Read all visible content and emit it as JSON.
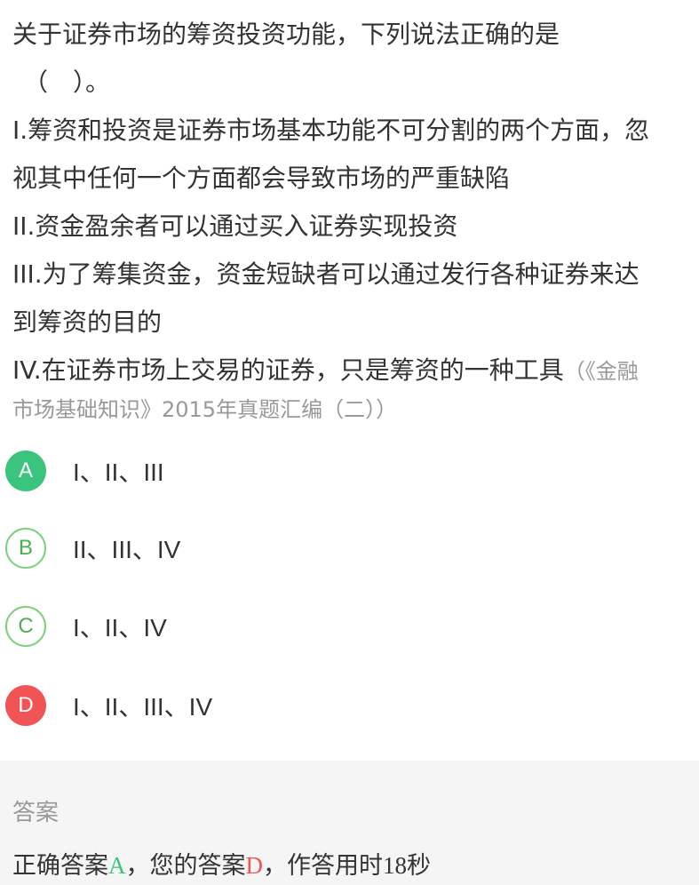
{
  "question": {
    "stem_line1": "关于证券市场的筹资投资功能，下列说法正确的是",
    "stem_line2": "（　）。",
    "item1_line1": "I.筹资和投资是证券市场基本功能不可分割的两个方面，忽",
    "item1_line2": "视其中任何一个方面都会导致市场的严重缺陷",
    "item2": "II.资金盈余者可以通过买入证券实现投资",
    "item3_line1": "III.为了筹集资金，资金短缺者可以通过发行各种证券来达",
    "item3_line2": "到筹资的目的",
    "item4": "IV.在证券市场上交易的证券，只是筹资的一种工具",
    "source_part1": "（《金融",
    "source_part2": "市场基础知识》2015年真题汇编（二））"
  },
  "options": [
    {
      "letter": "A",
      "text": "I、II、III",
      "state": "correct"
    },
    {
      "letter": "B",
      "text": "II、III、IV",
      "state": "plain"
    },
    {
      "letter": "C",
      "text": "I、II、IV",
      "state": "plain"
    },
    {
      "letter": "D",
      "text": "I、II、III、IV",
      "state": "wrong"
    }
  ],
  "answer": {
    "title": "答案",
    "prefix_correct": "正确答案",
    "correct_letter": "A",
    "mid_text": "，您的答案",
    "my_letter": "D",
    "suffix_text": "，作答用时",
    "time_value": "18",
    "time_unit": "秒"
  },
  "colors": {
    "correct": "#3ac47d",
    "wrong": "#f05454",
    "plain_border": "#7cd07c",
    "muted": "#999999",
    "panel_bg": "#f5f5f5"
  }
}
